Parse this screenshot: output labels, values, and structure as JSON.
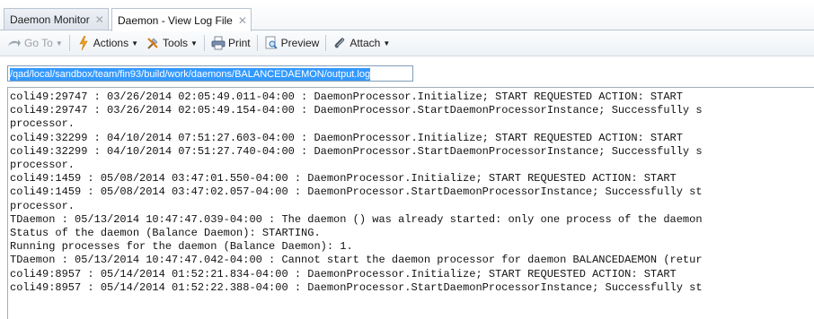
{
  "tabs": [
    {
      "label": "Daemon Monitor",
      "active": false
    },
    {
      "label": "Daemon - View Log File",
      "active": true
    }
  ],
  "toolbar": {
    "goto_label": "Go To",
    "actions_label": "Actions",
    "tools_label": "Tools",
    "print_label": "Print",
    "preview_label": "Preview",
    "attach_label": "Attach",
    "icons": [
      "goto-arrow-icon",
      "actions-lightning-icon",
      "tools-icon",
      "printer-icon",
      "preview-icon",
      "paperclip-icon"
    ]
  },
  "path": {
    "value": "/qad/local/sandbox/team/fin93/build/work/daemons/BALANCEDAEMON/output.log"
  },
  "log": {
    "lines": [
      "coli49:29747 : 03/26/2014 02:05:49.011-04:00 : DaemonProcessor.Initialize; START REQUESTED ACTION: START",
      "coli49:29747 : 03/26/2014 02:05:49.154-04:00 : DaemonProcessor.StartDaemonProcessorInstance; Successfully s",
      "processor.",
      "coli49:32299 : 04/10/2014 07:51:27.603-04:00 : DaemonProcessor.Initialize; START REQUESTED ACTION: START",
      "coli49:32299 : 04/10/2014 07:51:27.740-04:00 : DaemonProcessor.StartDaemonProcessorInstance; Successfully s",
      "processor.",
      "coli49:1459 : 05/08/2014 03:47:01.550-04:00 : DaemonProcessor.Initialize; START REQUESTED ACTION: START",
      "coli49:1459 : 05/08/2014 03:47:02.057-04:00 : DaemonProcessor.StartDaemonProcessorInstance; Successfully st",
      "processor.",
      "TDaemon : 05/13/2014 10:47:47.039-04:00 : The daemon () was already started: only one process of the daemon",
      "Status of the daemon (Balance Daemon): STARTING.",
      "Running processes for the daemon (Balance Daemon): 1.",
      "TDaemon : 05/13/2014 10:47:47.042-04:00 : Cannot start the daemon processor for daemon BALANCEDAEMON (retur",
      "coli49:8957 : 05/14/2014 01:52:21.834-04:00 : DaemonProcessor.Initialize; START REQUESTED ACTION: START",
      "coli49:8957 : 05/14/2014 01:52:22.388-04:00 : DaemonProcessor.StartDaemonProcessorInstance; Successfully st"
    ]
  },
  "colors": {
    "selection": "#3399ff",
    "tab_border": "#b9c4d3",
    "field_border": "#7f9db9"
  }
}
